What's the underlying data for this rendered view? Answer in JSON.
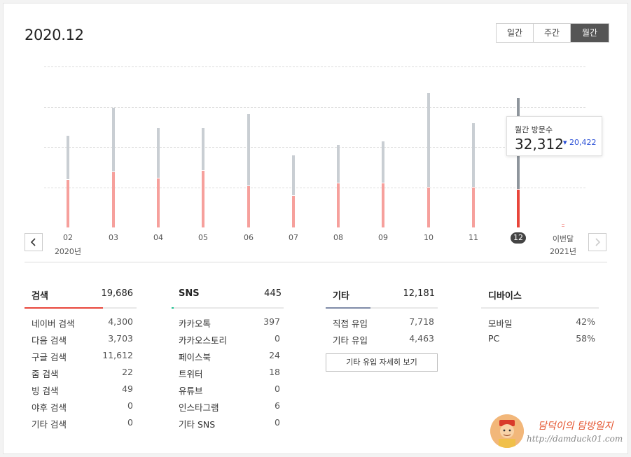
{
  "header": {
    "title": "2020.12"
  },
  "period_tabs": [
    {
      "label": "일간",
      "active": false
    },
    {
      "label": "주간",
      "active": false
    },
    {
      "label": "월간",
      "active": true
    }
  ],
  "chart_data": {
    "type": "bar",
    "categories": [
      "02",
      "03",
      "04",
      "05",
      "06",
      "07",
      "08",
      "09",
      "10",
      "11",
      "12",
      "이번달"
    ],
    "series": [
      {
        "values": [
          22900,
          29900,
          24900,
          24900,
          28400,
          18000,
          20700,
          21500,
          33600,
          26100,
          32312,
          0
        ]
      },
      {
        "values": [
          12000,
          14000,
          12400,
          14300,
          10500,
          8100,
          11200,
          11200,
          10200,
          10100,
          9600,
          0
        ]
      }
    ],
    "year_labels": {
      "start": "2020년",
      "end": "2021년"
    },
    "selected": "12",
    "tooltip": {
      "label": "월간 방문수",
      "value": "32,312",
      "delta": "20,422",
      "delta_arrow": "▾"
    },
    "colors": {
      "total": "#c9ced3",
      "part": "#f6a09c",
      "selected_total": "#8e959c",
      "selected_part": "#e8463b"
    }
  },
  "nav": {
    "prev_icon": "chevron-left-icon",
    "next_icon": "chevron-right-icon"
  },
  "stats": [
    {
      "label": "검색",
      "total": "19,686",
      "color": "#e8463b",
      "fill": 0.7,
      "rows": [
        {
          "k": "네이버 검색",
          "v": "4,300"
        },
        {
          "k": "다음 검색",
          "v": "3,703"
        },
        {
          "k": "구글 검색",
          "v": "11,612"
        },
        {
          "k": "줌 검색",
          "v": "22"
        },
        {
          "k": "빙 검색",
          "v": "49"
        },
        {
          "k": "야후 검색",
          "v": "0"
        },
        {
          "k": "기타 검색",
          "v": "0"
        }
      ]
    },
    {
      "label": "SNS",
      "total": "445",
      "color": "#1fbf8f",
      "fill": 0.02,
      "rows": [
        {
          "k": "카카오톡",
          "v": "397"
        },
        {
          "k": "카카오스토리",
          "v": "0"
        },
        {
          "k": "페이스북",
          "v": "24"
        },
        {
          "k": "트위터",
          "v": "18"
        },
        {
          "k": "유튜브",
          "v": "0"
        },
        {
          "k": "인스타그램",
          "v": "6"
        },
        {
          "k": "기타 SNS",
          "v": "0"
        }
      ]
    },
    {
      "label": "기타",
      "total": "12,181",
      "color": "#7f8ba8",
      "fill": 0.4,
      "rows": [
        {
          "k": "직접 유입",
          "v": "7,718"
        },
        {
          "k": "기타 유입",
          "v": "4,463"
        }
      ],
      "button": "기타 유입 자세히 보기"
    },
    {
      "label": "디바이스",
      "total": "",
      "color": "#e8e8e8",
      "fill": 0,
      "rows": [
        {
          "k": "모바일",
          "v": "42%"
        },
        {
          "k": "PC",
          "v": "58%"
        }
      ]
    }
  ],
  "watermark": {
    "title": "담덕이의 탐방일지",
    "url": "http://damduck01.com"
  }
}
